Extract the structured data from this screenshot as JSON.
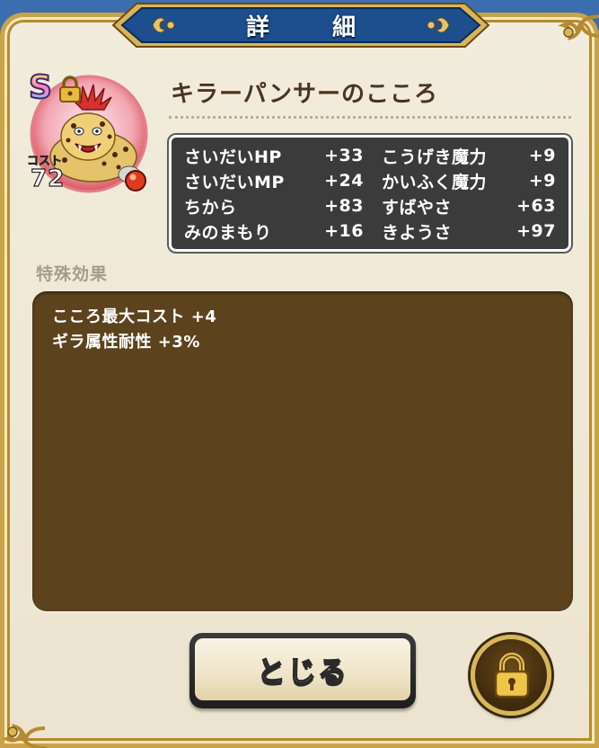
{
  "dialog": {
    "title": "詳　細"
  },
  "item": {
    "rank": "S",
    "name": "キラーパンサーのこころ",
    "cost_label": "コスト",
    "cost_value": "72",
    "locked": true
  },
  "stats": {
    "left": [
      {
        "name": "さいだいHP",
        "value": "+33"
      },
      {
        "name": "さいだいMP",
        "value": "+24"
      },
      {
        "name": "ちから",
        "value": "+83"
      },
      {
        "name": "みのまもり",
        "value": "+16"
      }
    ],
    "right": [
      {
        "name": "こうげき魔力",
        "value": "+9"
      },
      {
        "name": "かいふく魔力",
        "value": "+9"
      },
      {
        "name": "すばやさ",
        "value": "+63"
      },
      {
        "name": "きようさ",
        "value": "+97"
      }
    ]
  },
  "special_effects": {
    "label": "特殊効果",
    "lines": [
      "こころ最大コスト +4",
      "ギラ属性耐性 +3%"
    ]
  },
  "buttons": {
    "close_label": "とじる",
    "lock_icon": "padlock-icon"
  },
  "colors": {
    "panel_bg": "#efe7d3",
    "stats_bg": "#3b3b3b",
    "effects_bg": "#5c431e",
    "gold_border": "#c9a24a",
    "title_plaque": "#1d4f8f"
  }
}
